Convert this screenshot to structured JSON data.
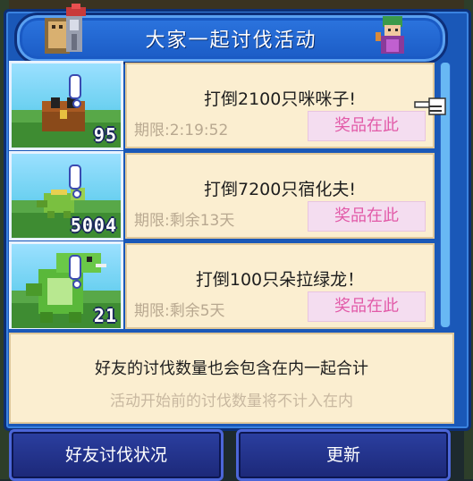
{
  "dialog": {
    "title": "大家一起讨伐活动"
  },
  "quests": [
    {
      "title": "打倒2100只咪咪子!",
      "deadline": "期限:2:19:52",
      "prize_label": "奖品在此",
      "count_badge": "95",
      "monster_icon": "treasure-chest-monster"
    },
    {
      "title": "打倒7200只宿化夫!",
      "deadline": "期限:剩余13天",
      "prize_label": "奖品在此",
      "count_badge": "5004",
      "monster_icon": "green-lizard-monster"
    },
    {
      "title": "打倒100只朵拉绿龙！",
      "deadline": "期限:剩余5天",
      "prize_label": "奖品在此",
      "count_badge": "21",
      "monster_icon": "green-dragon-monster"
    }
  ],
  "info": {
    "main": "好友的讨伐数量也会包含在内一起合计",
    "sub": "活动开始前的讨伐数量将不计入在内"
  },
  "buttons": {
    "friends_status": "好友讨伐状况",
    "refresh": "更新"
  },
  "colors": {
    "frame_blue": "#1a58b8",
    "card_cream": "#fbeed0",
    "prize_pink": "#e25aa8",
    "button_navy": "#1c2878"
  }
}
